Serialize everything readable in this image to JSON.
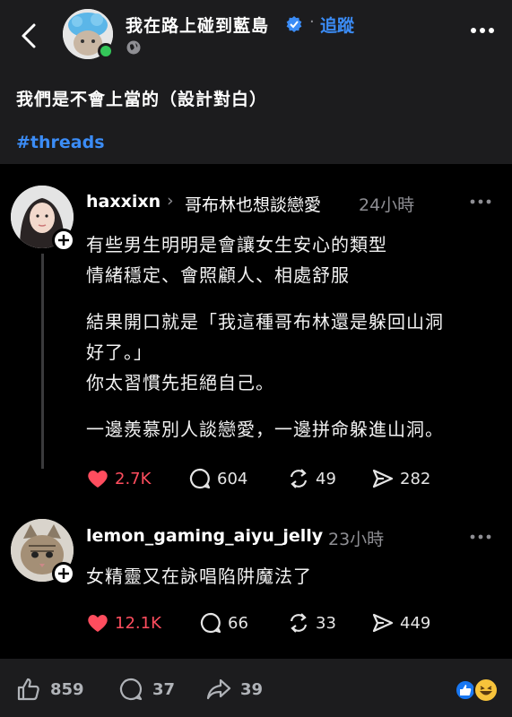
{
  "header": {
    "page_name": "我在路上碰到藍島",
    "follow_label": "追蹤",
    "separator": "·"
  },
  "post": {
    "title": "我們是不會上當的（設計對白）",
    "hashtag": "#threads"
  },
  "comments": [
    {
      "username": "haxxixn",
      "chevron": "›",
      "reply_to": "哥布林也想談戀愛",
      "time": "24小時",
      "lines": [
        "有些男生明明是會讓女生安心的類型",
        "情緒穩定、會照顧人、相處舒服",
        "結果開口就是「我這種哥布林還是躲回山洞",
        "好了。」",
        "你太習慣先拒絕自己。",
        "一邊羨慕別人談戀愛，一邊拼命躲進山洞。"
      ],
      "likes": "2.7K",
      "replies": "604",
      "reposts": "49",
      "shares": "282"
    },
    {
      "username": "lemon_gaming_aiyu_jelly",
      "time": "23小時",
      "lines": [
        "女精靈又在詠唱陷阱魔法了"
      ],
      "likes": "12.1K",
      "replies": "66",
      "reposts": "33",
      "shares": "449"
    }
  ],
  "footer": {
    "likes": "859",
    "comments": "37",
    "shares": "39"
  },
  "colors": {
    "accent_blue": "#3b8cf6",
    "like_red": "#ff4d5e",
    "fb_blue": "#1877f2"
  },
  "icons": [
    "back-arrow-icon",
    "verified-badge-icon",
    "globe-icon",
    "more-dots-icon",
    "plus-icon",
    "heart-icon",
    "comment-bubble-icon",
    "repost-icon",
    "send-icon",
    "thumbs-up-icon",
    "fb-comment-icon",
    "fb-share-icon",
    "like-reaction-icon",
    "haha-reaction-icon"
  ]
}
